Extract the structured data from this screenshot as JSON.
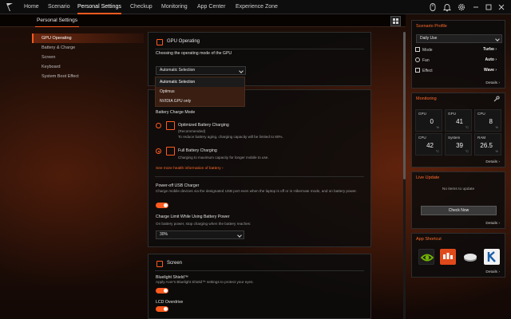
{
  "nav": {
    "tabs": [
      "Home",
      "Scenario",
      "Personal Settings",
      "Checkup",
      "Monitoring",
      "App Center",
      "Experience Zone"
    ],
    "active": "Personal Settings"
  },
  "page": {
    "title": "Personal Settings"
  },
  "sidebar": {
    "items": [
      "GPU Operating",
      "Battery & Charge",
      "Screen",
      "Keyboard",
      "System Boot Effect"
    ]
  },
  "gpu": {
    "title": "GPU Operating",
    "desc": "Choosing the operating mode of the GPU",
    "selected": "Automatic Selection",
    "options": [
      "Automatic Selection",
      "Optimus",
      "NVIDIA GPU only"
    ]
  },
  "battery": {
    "mode_label": "Battery Charge Mode",
    "optimized": {
      "title": "Optimized Battery Charging",
      "tag": "(Recommended)",
      "desc": "To reduce battery aging, charging capacity will be limited to 80%."
    },
    "full": {
      "title": "Full Battery Charging",
      "desc": "Charging to maximum capacity for longer mobile to use."
    },
    "link": "See more health information of battery",
    "usb_title": "Power-off USB Charger",
    "usb_desc": "Charge mobile devices via the designated USB port even when the laptop is off or in Hibernate mode, and on battery power.",
    "limit_title": "Charge Limit While Using Battery Power",
    "limit_desc": "On battery power, stop charging when the battery reaches:",
    "limit_value": "30%"
  },
  "screen": {
    "title": "Screen",
    "bluelight_title": "Bluelight Shield™",
    "bluelight_desc": "Apply Acer's Bluelight Shield™ settings to protect your eyes.",
    "lcd_title": "LCD Overdrive"
  },
  "scenario": {
    "title": "Scenario Profile",
    "profile": "Daily Use",
    "rows": [
      {
        "label": "Mode",
        "value": "Turbo"
      },
      {
        "label": "Fan",
        "value": "Auto"
      },
      {
        "label": "Effect",
        "value": "Wave"
      }
    ],
    "details": "Details"
  },
  "monitoring": {
    "title": "Monitoring",
    "tiles": [
      {
        "label": "GPU",
        "value": "0",
        "unit": "%"
      },
      {
        "label": "GPU",
        "value": "41",
        "unit": "°C"
      },
      {
        "label": "CPU",
        "value": "8",
        "unit": "%"
      },
      {
        "label": "CPU",
        "value": "42",
        "unit": "°C"
      },
      {
        "label": "System",
        "value": "39",
        "unit": "°C"
      },
      {
        "label": "RAM",
        "value": "26.5",
        "unit": "%"
      }
    ],
    "details": "Details"
  },
  "live_update": {
    "title": "Live Update",
    "status": "No items to update",
    "button": "Check Now",
    "details": "Details"
  },
  "app_shortcut": {
    "title": "App Shortcut",
    "apps": [
      "nvidia-icon",
      "dts-icon",
      "disc-icon",
      "k-app-icon"
    ],
    "details": "Details"
  },
  "colors": {
    "accent": "#ff5a1f"
  }
}
